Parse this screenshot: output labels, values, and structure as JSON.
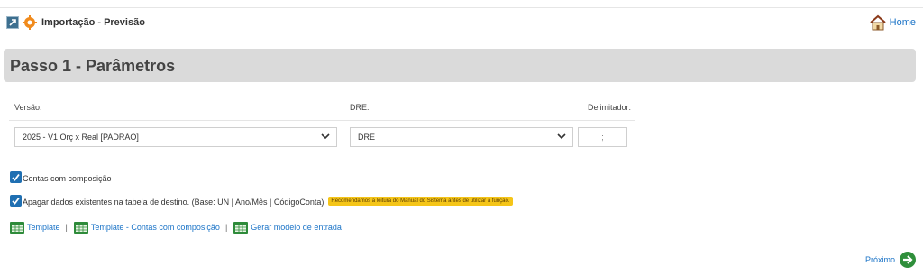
{
  "header": {
    "title": "Importação - Previsão",
    "home_label": "Home"
  },
  "step": {
    "title": "Passo 1 - Parâmetros"
  },
  "params": {
    "versao_label": "Versão:",
    "versao_value": "2025 - V1 Orç x Real  [PADRÃO]",
    "dre_label": "DRE:",
    "dre_value": "DRE",
    "delimitador_label": "Delimitador:",
    "delimitador_value": ";"
  },
  "options": {
    "contas_label": "Contas com composição",
    "contas_checked": true,
    "apagar_label": "Apagar dados existentes na tabela de destino. (Base: UN | Ano/Mês | CódigoConta)",
    "apagar_checked": true,
    "apagar_hint": "Recomendamos a leitura do Manual do Sistema antes de utilizar a função."
  },
  "links": {
    "template": "Template",
    "template_composicao": "Template - Contas com composição",
    "gerar_modelo": "Gerar modelo de entrada",
    "separator": "|"
  },
  "footer": {
    "next_label": "Próximo"
  },
  "colors": {
    "link": "#1a73c7",
    "step_bg": "#dadada",
    "checkbox": "#1f6fb2",
    "hint_bg": "#f5c518"
  }
}
